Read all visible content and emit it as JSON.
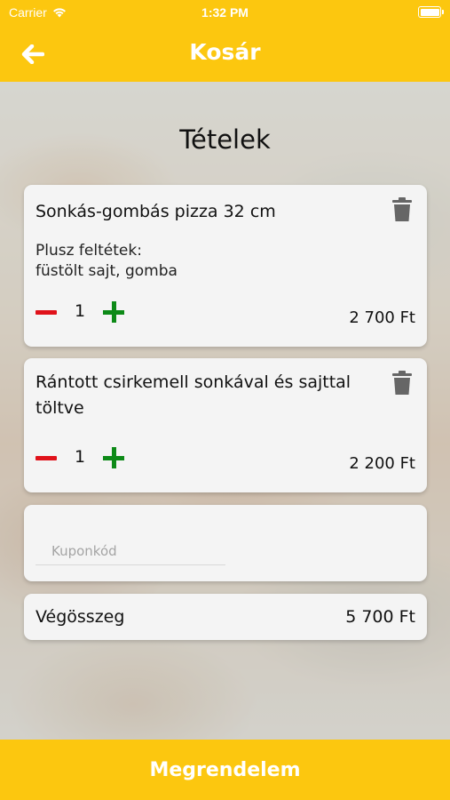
{
  "status_bar": {
    "carrier": "Carrier",
    "time": "1:32 PM"
  },
  "nav": {
    "title": "Kosár"
  },
  "section_title": "Tételek",
  "cart_items": [
    {
      "name": "Sonkás-gombás pizza 32 cm",
      "extras_label": "Plusz feltétek:",
      "extras": "füstölt sajt, gomba",
      "quantity": "1",
      "price": "2 700 Ft"
    },
    {
      "name": "Rántott csirkemell sonkával és sajttal töltve",
      "quantity": "1",
      "price": "2 200 Ft"
    }
  ],
  "coupon": {
    "placeholder": "Kuponkód",
    "value": ""
  },
  "total": {
    "label": "Végösszeg",
    "value": "5 700 Ft"
  },
  "order_button": "Megrendelem",
  "colors": {
    "accent": "#fcc70f",
    "minus": "#e0121a",
    "plus": "#0d8a17",
    "card": "#f4f4f4"
  }
}
